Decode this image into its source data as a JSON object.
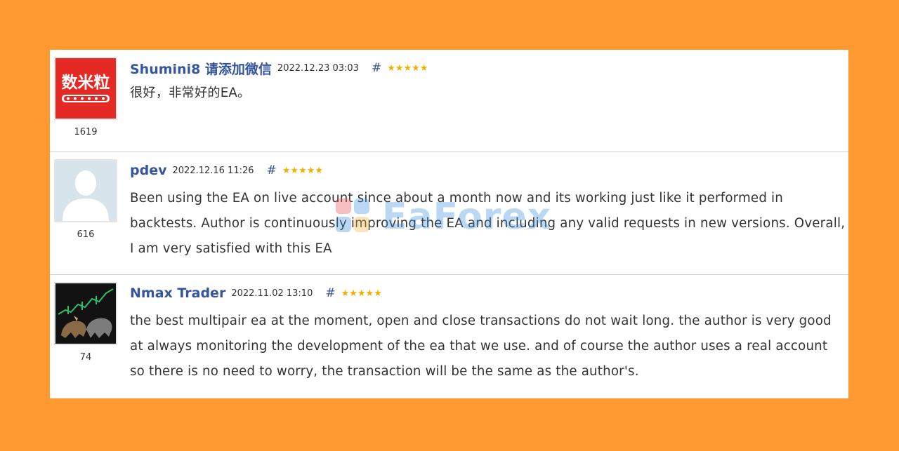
{
  "reviews": [
    {
      "author": "Shumini8 请添加微信",
      "date": "2022.12.23 03:03",
      "hash": "#",
      "stars": "★★★★★",
      "rating": 5,
      "count": "1619",
      "text": "很好，非常好的EA。",
      "avatar_text": "数米粒",
      "avatar_icon": "brand-logo-avatar",
      "avatar_color": "#e52a25"
    },
    {
      "author": "pdev",
      "date": "2022.12.16 11:26",
      "hash": "#",
      "stars": "★★★★★",
      "rating": 5,
      "count": "616",
      "text": "Been using the EA on live account since about a month now and its working just like it performed in backtests. Author is continuously improving the EA and including any valid requests in new versions. Overall, I am very satisfied with this EA",
      "avatar_icon": "default-user-avatar",
      "avatar_color": "#d4e2ea"
    },
    {
      "author": "Nmax Trader",
      "date": "2022.11.02 13:10",
      "hash": "#",
      "stars": "★★★★★",
      "rating": 5,
      "count": "74",
      "text": "the best multipair ea at the moment, open and close transactions do not wait long. the author is very good at always monitoring the development of the ea that we use. and of course the author uses a real account so there is no need to worry, the transaction will be the same as the author's.",
      "avatar_icon": "bull-bear-chart-avatar",
      "avatar_color": "#151515"
    }
  ],
  "watermark": {
    "text": "EaForex"
  },
  "colors": {
    "background": "#FF9A33",
    "author_link": "#35559d",
    "star": "#f0b000"
  }
}
